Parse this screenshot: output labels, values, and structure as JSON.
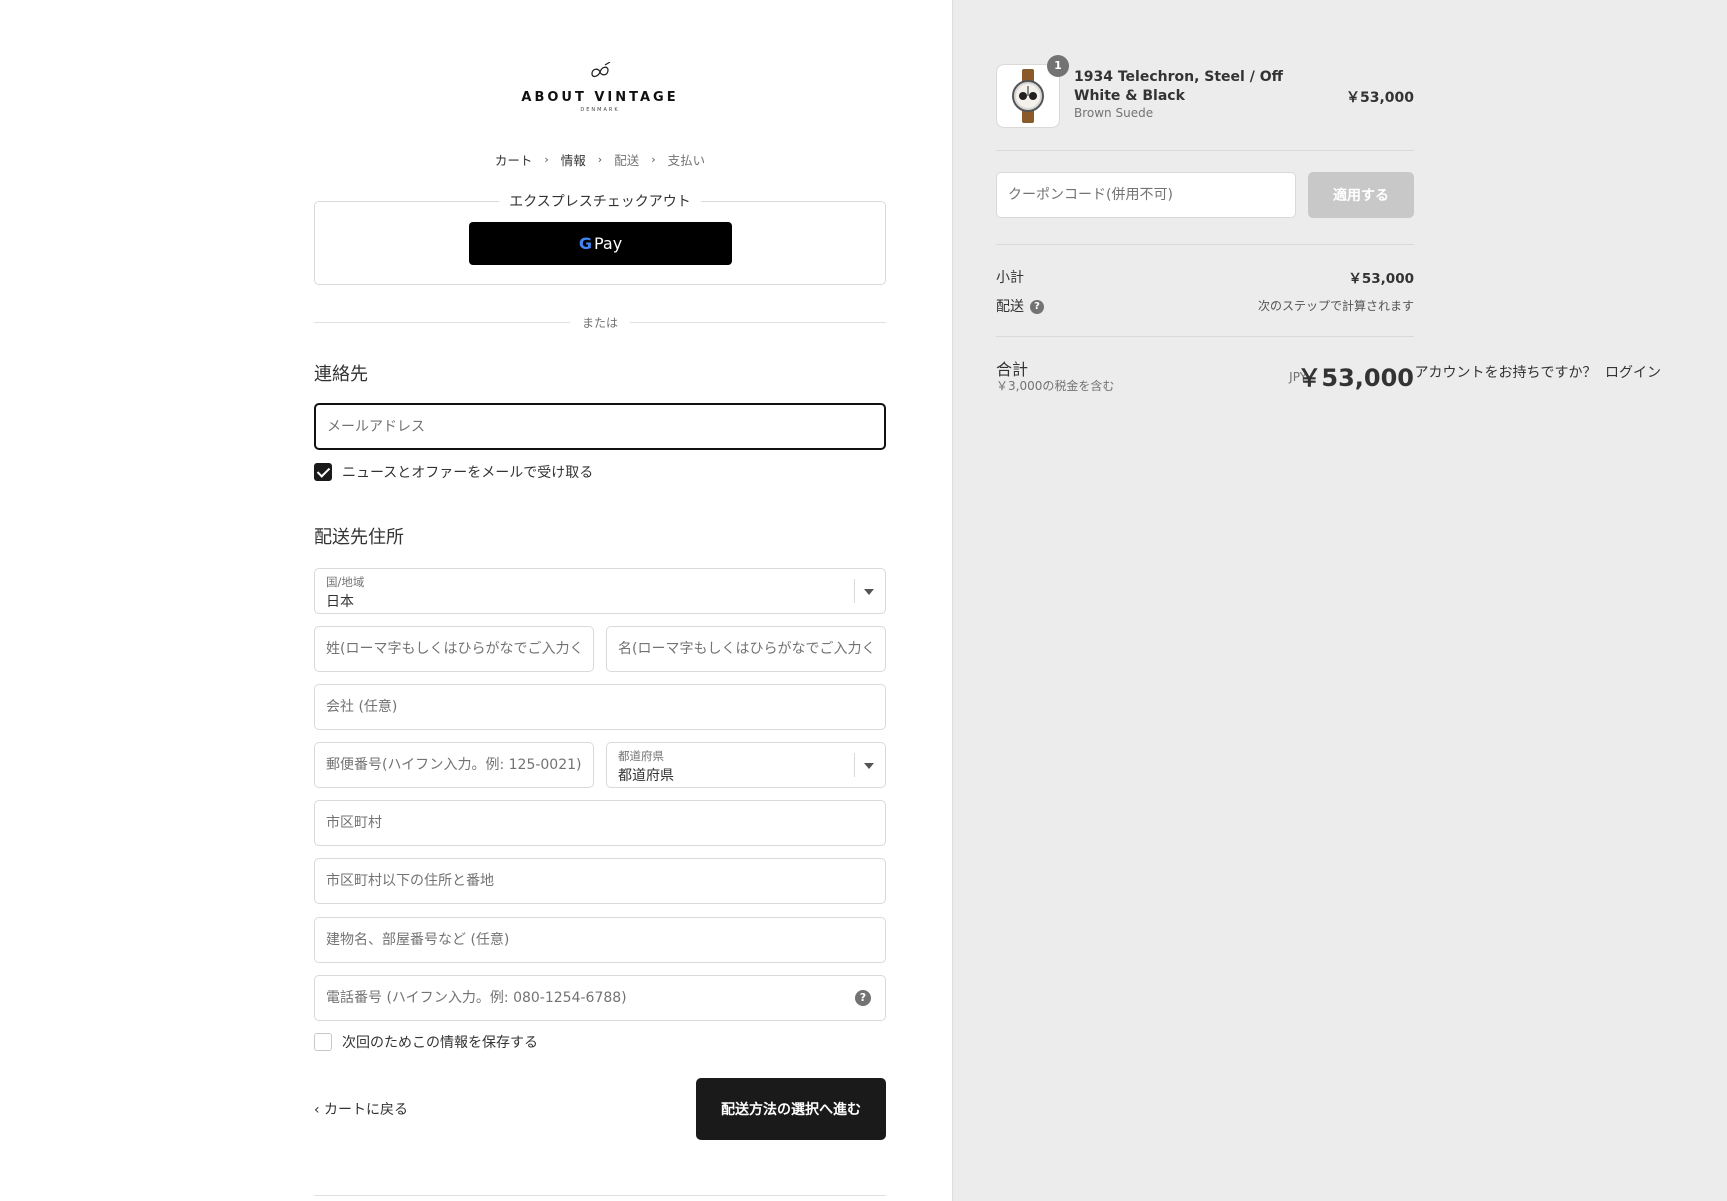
{
  "brand": {
    "name": "ABOUT VINTAGE",
    "sub": "DENMARK"
  },
  "breadcrumb": [
    "カート",
    "情報",
    "配送",
    "支払い"
  ],
  "express": {
    "title": "エクスプレスチェックアウト",
    "gpay_label": "Pay",
    "gpay_g": "G"
  },
  "divider_text": "または",
  "contact": {
    "title": "連絡先",
    "account_prompt": "アカウントをお持ちですか？",
    "login_link": "ログイン",
    "email_placeholder": "メールアドレス",
    "newsletter_label": "ニュースとオファーをメールで受け取る"
  },
  "shipping": {
    "title": "配送先住所",
    "country_label": "国/地域",
    "country_value": "日本",
    "last_name_placeholder": "姓(ローマ字もしくはひらがなでご入力ください)",
    "first_name_placeholder": "名(ローマ字もしくはひらがなでご入力ください)",
    "company_placeholder": "会社 (任意)",
    "postal_placeholder": "郵便番号(ハイフン入力。例: 125-0021)",
    "prefecture_label": "都道府県",
    "prefecture_value": "都道府県",
    "city_placeholder": "市区町村",
    "address_placeholder": "市区町村以下の住所と番地",
    "building_placeholder": "建物名、部屋番号など (任意)",
    "phone_placeholder": "電話番号 (ハイフン入力。例: 080-1254-6788)",
    "save_info_label": "次回のためこの情報を保存する"
  },
  "footer": {
    "back_label": "‹ カートに戻る",
    "continue_label": "配送方法の選択へ進む"
  },
  "summary": {
    "product": {
      "name": "1934 Telechron, Steel / Off White & Black",
      "variant": "Brown Suede",
      "price": "￥53,000",
      "quantity": "1"
    },
    "coupon_placeholder": "クーポンコード(併用不可)",
    "apply_label": "適用する",
    "subtotal_label": "小計",
    "subtotal_value": "￥53,000",
    "shipping_label": "配送",
    "shipping_value": "次のステップで計算されます",
    "total_label": "合計",
    "tax_note": "￥3,000の税金を含む",
    "currency": "JPY",
    "total_value": "￥53,000"
  }
}
